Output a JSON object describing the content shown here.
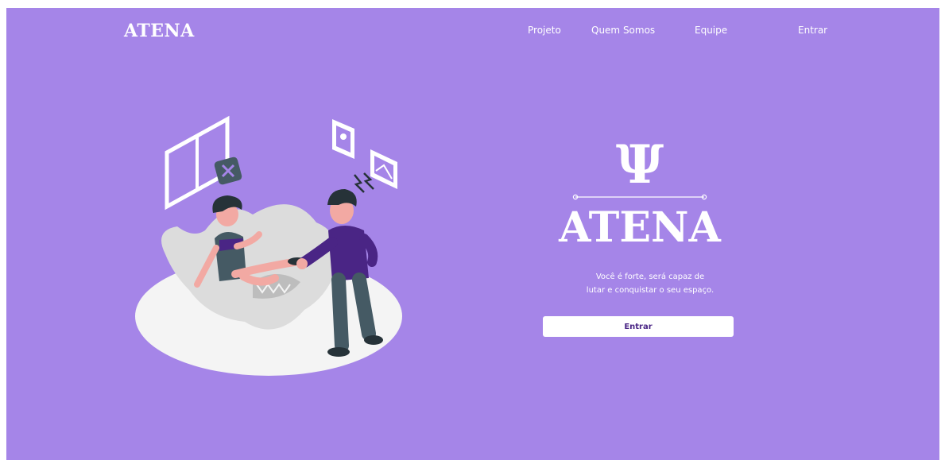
{
  "header": {
    "brand": "ATENA",
    "nav": [
      "Projeto",
      "Quem Somos",
      "Equipe",
      "Entrar"
    ]
  },
  "hero": {
    "logo_symbol": "Ψ",
    "logo_text": "ATENA",
    "tagline_line1": "Você é forte, será capaz de",
    "tagline_line2": "lutar e conquistar o seu espaço.",
    "cta_label": "Entrar"
  },
  "colors": {
    "background": "#a585e8",
    "text": "#ffffff",
    "cta_text": "#4a2585"
  }
}
